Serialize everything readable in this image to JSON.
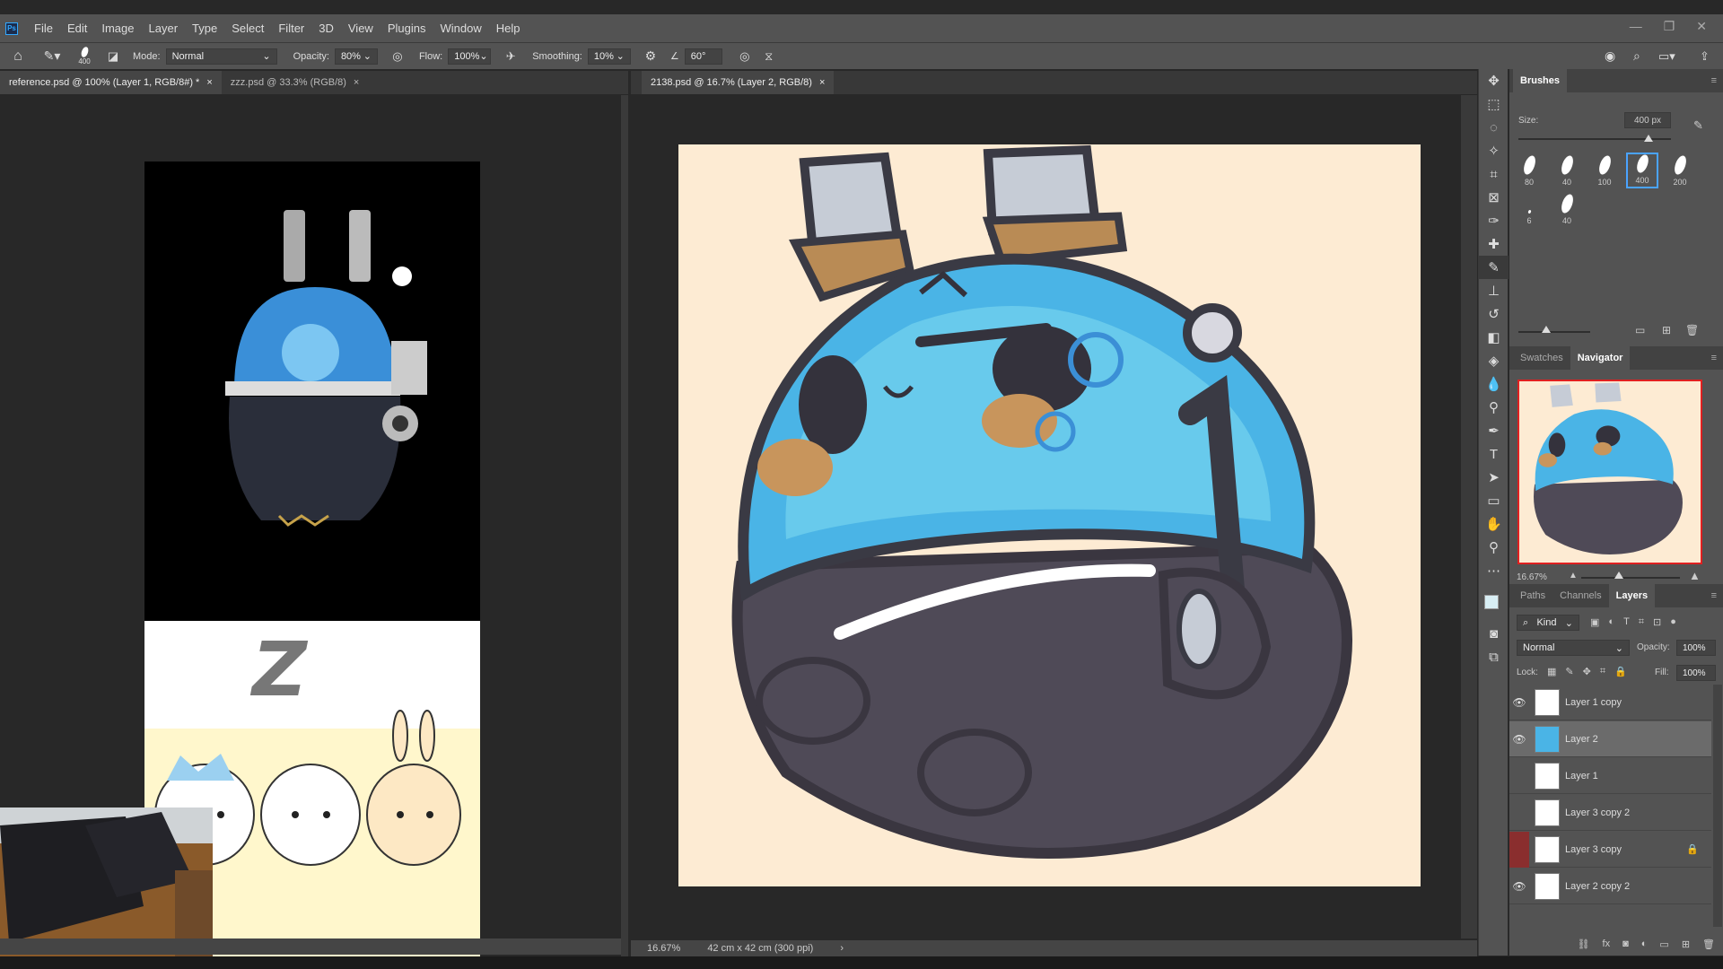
{
  "menu": {
    "logo": "Ps",
    "items": [
      "File",
      "Edit",
      "Image",
      "Layer",
      "Type",
      "Select",
      "Filter",
      "3D",
      "View",
      "Plugins",
      "Window",
      "Help"
    ]
  },
  "options": {
    "brush_size": "400",
    "mode_label": "Mode:",
    "mode_value": "Normal",
    "opacity_label": "Opacity:",
    "opacity_value": "80%",
    "flow_label": "Flow:",
    "flow_value": "100%",
    "smoothing_label": "Smoothing:",
    "smoothing_value": "10%",
    "angle_value": "60°"
  },
  "tabs": {
    "left": [
      {
        "label": "reference.psd @ 100% (Layer 1, RGB/8#) *"
      },
      {
        "label": "zzz.psd @ 33.3% (RGB/8)"
      }
    ],
    "right": [
      {
        "label": "2138.psd @ 16.7% (Layer 2, RGB/8)"
      }
    ],
    "close": "×"
  },
  "reference": {
    "z_text": "Z"
  },
  "status": {
    "zoom": "16.67%",
    "doc_info": "42 cm x 42 cm (300 ppi)",
    "arrow": "›"
  },
  "brushes": {
    "title": "Brushes",
    "size_label": "Size:",
    "size_value": "400 px",
    "presets": [
      "80",
      "40",
      "100",
      "400",
      "200",
      "6",
      "40"
    ]
  },
  "navigator": {
    "tabs": [
      "Swatches",
      "Navigator"
    ],
    "zoom": "16.67%"
  },
  "layers": {
    "tabs": [
      "Paths",
      "Channels",
      "Layers"
    ],
    "kind": "Kind",
    "blend": "Normal",
    "opacity_label": "Opacity:",
    "opacity_value": "100%",
    "lock_label": "Lock:",
    "fill_label": "Fill:",
    "fill_value": "100%",
    "rows": [
      {
        "name": "Layer 1 copy",
        "visible": true
      },
      {
        "name": "Layer 2",
        "visible": true,
        "selected": true
      },
      {
        "name": "Layer 1",
        "visible": false
      },
      {
        "name": "Layer 3 copy 2",
        "visible": false
      },
      {
        "name": "Layer 3 copy",
        "visible": false,
        "locked": true
      },
      {
        "name": "Layer 2 copy 2",
        "visible": true
      }
    ]
  },
  "colors": {
    "canvas_bg": "#fdebd3",
    "glass_blue": "#4ab4e6",
    "dark_body": "#4f4a57",
    "accent_select": "#4aa3ff"
  }
}
